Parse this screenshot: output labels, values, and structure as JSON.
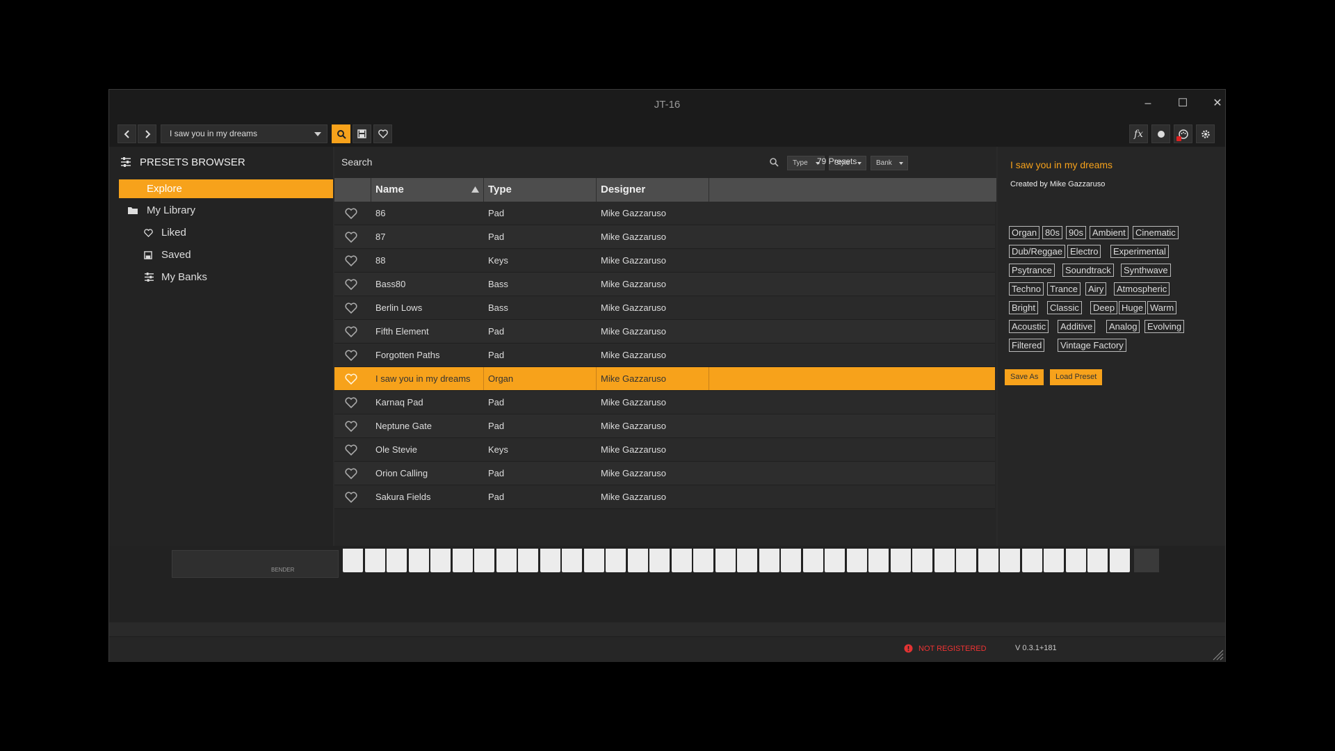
{
  "window": {
    "title": "JT-16",
    "controls": {
      "minimize": "–",
      "maximize": "☐",
      "close": "✕"
    }
  },
  "toolbar": {
    "back_icon": "chevron-left-icon",
    "forward_icon": "chevron-right-icon",
    "current_preset": "I saw you in my dreams",
    "search_icon": "search-icon",
    "save_icon": "save-icon",
    "favorite_icon": "heart-icon",
    "fx_label": "fx",
    "accent": "#f7a21b"
  },
  "sidebar": {
    "header": "PRESETS BROWSER",
    "items": [
      {
        "label": "Explore",
        "icon": "",
        "active": true
      },
      {
        "label": "My Library",
        "icon": "folder-icon"
      },
      {
        "label": "Liked",
        "icon": "heart-icon"
      },
      {
        "label": "Saved",
        "icon": "save-icon"
      },
      {
        "label": "My Banks",
        "icon": "sliders-icon"
      }
    ]
  },
  "list": {
    "search_placeholder": "Search",
    "filters": [
      "Type",
      "Style",
      "Bank"
    ],
    "count": "79 Presets",
    "columns": [
      "Name",
      "Type",
      "Designer"
    ],
    "rows": [
      {
        "name": "86",
        "type": "Pad",
        "designer": "Mike Gazzaruso"
      },
      {
        "name": "87",
        "type": "Pad",
        "designer": "Mike Gazzaruso"
      },
      {
        "name": "88",
        "type": "Keys",
        "designer": "Mike Gazzaruso"
      },
      {
        "name": "Bass80",
        "type": "Bass",
        "designer": "Mike Gazzaruso"
      },
      {
        "name": "Berlin Lows",
        "type": "Bass",
        "designer": "Mike Gazzaruso"
      },
      {
        "name": "Fifth Element",
        "type": "Pad",
        "designer": "Mike Gazzaruso"
      },
      {
        "name": "Forgotten Paths",
        "type": "Pad",
        "designer": "Mike Gazzaruso"
      },
      {
        "name": "I saw you in my dreams",
        "type": "Organ",
        "designer": "Mike Gazzaruso",
        "selected": true
      },
      {
        "name": "Karnaq Pad",
        "type": "Pad",
        "designer": "Mike Gazzaruso"
      },
      {
        "name": "Neptune Gate",
        "type": "Pad",
        "designer": "Mike Gazzaruso"
      },
      {
        "name": "Ole Stevie",
        "type": "Keys",
        "designer": "Mike Gazzaruso"
      },
      {
        "name": "Orion Calling",
        "type": "Pad",
        "designer": "Mike Gazzaruso"
      },
      {
        "name": "Sakura Fields",
        "type": "Pad",
        "designer": "Mike Gazzaruso"
      }
    ]
  },
  "details": {
    "title": "I saw you in my dreams",
    "created_by": "Created by Mike Gazzaruso",
    "tags": [
      [
        "Organ",
        "80s",
        "90s",
        "Ambient",
        "Cinematic"
      ],
      [
        "Dub/Reggae",
        "Electro",
        "Experimental"
      ],
      [
        "Psytrance",
        "Soundtrack",
        "Synthwave"
      ],
      [
        "Techno",
        "Trance",
        "Airy",
        "Atmospheric"
      ],
      [
        "Bright",
        "Classic",
        "Deep",
        "Huge",
        "Warm"
      ],
      [
        "Acoustic",
        "Additive",
        "Analog",
        "Evolving"
      ],
      [
        "Filtered",
        "Vintage Factory"
      ]
    ],
    "save_as": "Save As",
    "load_preset": "Load Preset"
  },
  "keyboard": {
    "bender_label": "BENDER",
    "white_keys": 36
  },
  "status": {
    "registration": "NOT REGISTERED",
    "version": "V 0.3.1+181",
    "error_color": "#e33333"
  }
}
